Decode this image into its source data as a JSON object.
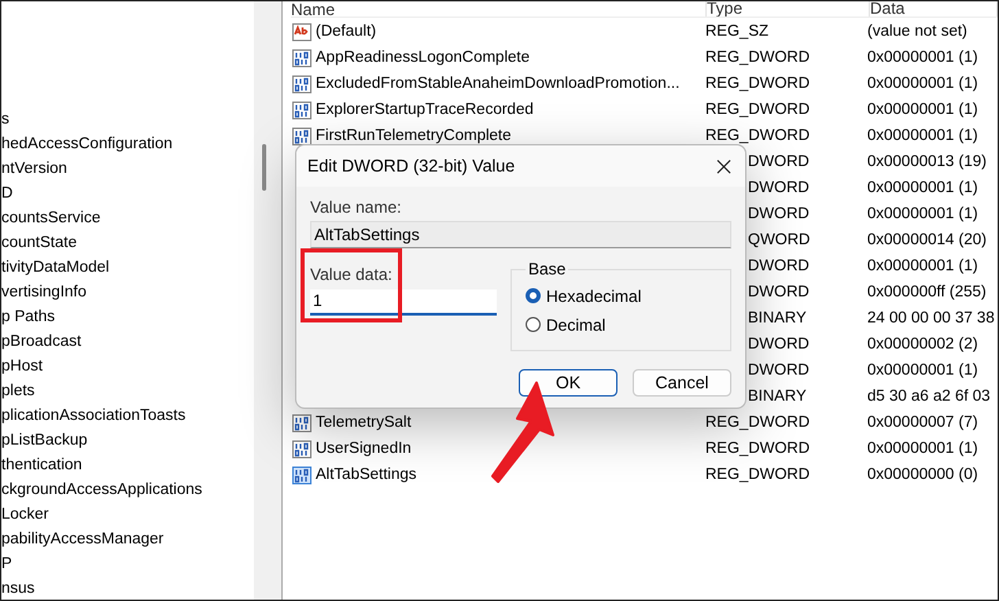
{
  "tree": {
    "items": [
      {
        "label": "s"
      },
      {
        "label": "hedAccessConfiguration"
      },
      {
        "label": "ntVersion"
      },
      {
        "label": "D"
      },
      {
        "label": "countsService"
      },
      {
        "label": "countState"
      },
      {
        "label": "tivityDataModel"
      },
      {
        "label": "vertisingInfo"
      },
      {
        "label": "p Paths"
      },
      {
        "label": "pBroadcast"
      },
      {
        "label": "pHost"
      },
      {
        "label": "plets"
      },
      {
        "label": "plicationAssociationToasts"
      },
      {
        "label": "pListBackup"
      },
      {
        "label": "thentication"
      },
      {
        "label": "ckgroundAccessApplications"
      },
      {
        "label": "Locker"
      },
      {
        "label": "pabilityAccessManager"
      },
      {
        "label": "P"
      },
      {
        "label": "nsus"
      }
    ]
  },
  "values": {
    "columns": [
      "Name",
      "Type",
      "Data"
    ],
    "rows": [
      {
        "kind": "string",
        "name": "(Default)",
        "type": "REG_SZ",
        "data": "(value not set)",
        "selected": false
      },
      {
        "kind": "binary",
        "name": "AppReadinessLogonComplete",
        "type": "REG_DWORD",
        "data": "0x00000001 (1)",
        "selected": false
      },
      {
        "kind": "binary",
        "name": "ExcludedFromStableAnaheimDownloadPromotion...",
        "type": "REG_DWORD",
        "data": "0x00000001 (1)",
        "selected": false
      },
      {
        "kind": "binary",
        "name": "ExplorerStartupTraceRecorded",
        "type": "REG_DWORD",
        "data": "0x00000001 (1)",
        "selected": false
      },
      {
        "kind": "binary",
        "name": "FirstRunTelemetryComplete",
        "type": "REG_DWORD",
        "data": "0x00000001 (1)",
        "selected": false
      },
      {
        "type": "DWORD",
        "data": "0x00000013 (19)"
      },
      {
        "type": "DWORD",
        "data": "0x00000001 (1)"
      },
      {
        "type": "DWORD",
        "data": "0x00000001 (1)"
      },
      {
        "type": "QWORD",
        "data": "0x00000014 (20)"
      },
      {
        "type": "DWORD",
        "data": "0x00000001 (1)"
      },
      {
        "type": "DWORD",
        "data": "0x000000ff (255)"
      },
      {
        "type": "BINARY",
        "data": "24 00 00 00 37 38"
      },
      {
        "type": "DWORD",
        "data": "0x00000002 (2)"
      },
      {
        "type": "DWORD",
        "data": "0x00000001 (1)"
      },
      {
        "type": "BINARY",
        "data": "d5 30 a6 a2 6f 03"
      },
      {
        "kind": "binary",
        "name": "TelemetrySalt",
        "type": "REG_DWORD",
        "data": "0x00000007 (7)",
        "selected": false
      },
      {
        "kind": "binary",
        "name": "UserSignedIn",
        "type": "REG_DWORD",
        "data": "0x00000001 (1)",
        "selected": false
      },
      {
        "kind": "binary",
        "name": "AltTabSettings",
        "type": "REG_DWORD",
        "data": "0x00000000 (0)",
        "selected": true
      }
    ]
  },
  "dialog": {
    "title": "Edit DWORD (32-bit) Value",
    "value_name_label": "Value name:",
    "value_name": "AltTabSettings",
    "value_data_label": "Value data:",
    "value_data": "1",
    "base": {
      "label": "Base",
      "options": [
        {
          "label": "Hexadecimal",
          "selected": true
        },
        {
          "label": "Decimal",
          "selected": false
        }
      ]
    },
    "buttons": [
      {
        "label": "OK",
        "default": true
      },
      {
        "label": "Cancel",
        "default": false
      }
    ]
  }
}
